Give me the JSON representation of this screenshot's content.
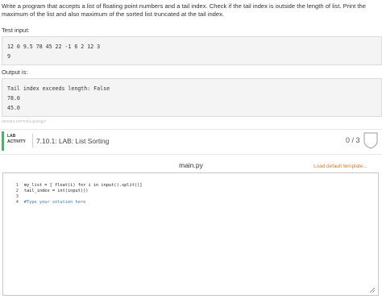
{
  "description": "Write a program that accepts a list of floating point numbers and a tail index. Check if the tail index is outside the length of list. Print the maximum of the list and also maximum of the sorted list truncated at the tail index.",
  "test_input_label": "Test input:",
  "test_input_lines": [
    "12 0 9.5 78 45 22 -1 6 2 12 3",
    "9"
  ],
  "output_label": "Output is:",
  "output_lines": [
    "Tail index exceeds length: False",
    "78.0",
    "45.0"
  ],
  "hash_text": "284284.1977024.qx3zqy7",
  "lab": {
    "tag_line1": "LAB",
    "tag_line2": "ACTIVITY",
    "title": "7.10.1: LAB: List Sorting",
    "score": "0 / 3",
    "accent_color": "#58a96a"
  },
  "editor": {
    "filename": "main.py",
    "load_template_label": "Load default template...",
    "lines": [
      {
        "num": "1",
        "text": "my_list = [ float(i) for i in input().split()]"
      },
      {
        "num": "2",
        "text": "tail_index = int(input())"
      },
      {
        "num": "3",
        "text": ""
      },
      {
        "num": "4",
        "text": "#Type your solution here"
      }
    ]
  }
}
